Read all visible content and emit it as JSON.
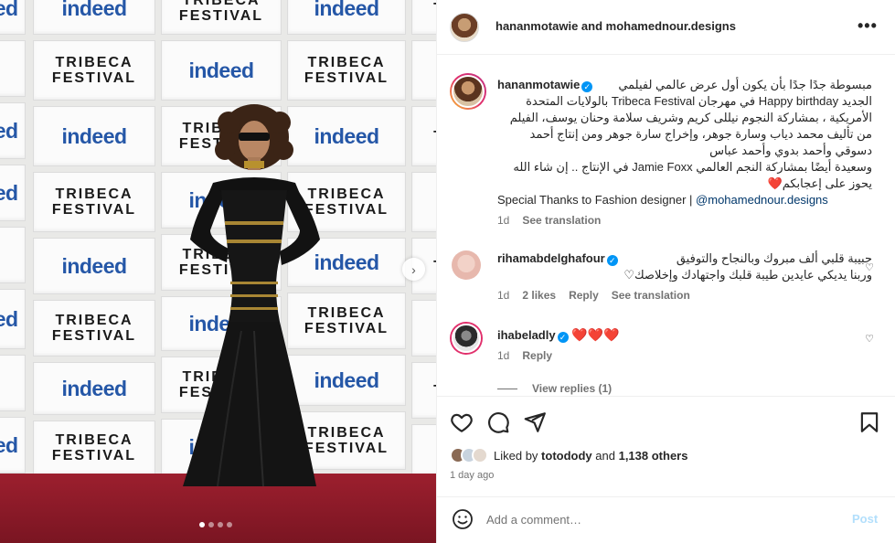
{
  "header": {
    "title": "hananmotawie and mohamednour.designs",
    "more_icon": "more-horizontal-icon"
  },
  "media": {
    "backdrop_logos": [
      "indeed",
      "TRIBECA FESTIVAL"
    ],
    "carousel_next_glyph": "›",
    "carousel_count": 4,
    "carousel_active": 0
  },
  "caption": {
    "username": "hananmotawie",
    "verified_glyph": "✓",
    "lines_ar": [
      "مبسوطة جدًا جدًا بأن يكون أول عرض عالمي لفيلمي",
      "الجديد Happy birthday في مهرجان Tribeca Festival بالولايات المتحدة",
      "الأمريكية ، بمشاركة النجوم نيللى كريم وشريف سلامة وحنان يوسف، الفيلم",
      "من تأليف محمد دياب وسارة جوهر، وإخراج سارة جوهر ومن إنتاج أحمد",
      "دسوقي وأحمد بدوي وأحمد عباس",
      "وسعيدة أيضًا بمشاركة النجم العالمي Jamie Foxx في الإنتاج .. إن شاء الله",
      "يحوز على إعجابكم❤️"
    ],
    "thanks_text": "Special Thanks to Fashion designer | ",
    "thanks_mention": "@mohamednour.designs",
    "time": "1d",
    "see_translation": "See translation"
  },
  "comments": [
    {
      "username": "rihamabdelghafour",
      "verified": true,
      "text_lines": [
        "حبيبة قلبي ألف مبروك وبالنجاح والتوفيق",
        "وربنا يديكي عايدين طيبة قلبك واجتهادك وإخلاصك♡"
      ],
      "time": "1d",
      "likes": "2 likes",
      "reply": "Reply",
      "see_translation": "See translation"
    },
    {
      "username": "ihabeladly",
      "verified": true,
      "text": "❤️❤️❤️",
      "time": "1d",
      "reply": "Reply",
      "view_replies": "View replies (1)"
    }
  ],
  "actions": {
    "like_icon": "heart-icon",
    "comment_icon": "comment-icon",
    "share_icon": "send-icon",
    "save_icon": "bookmark-icon",
    "liked_by_prefix": "Liked by",
    "liked_by_user": "totodody",
    "liked_by_and": "and",
    "liked_by_others": "1,138 others",
    "posted_time": "1 day ago"
  },
  "add_comment": {
    "emoji_icon": "smiley-icon",
    "placeholder": "Add a comment…",
    "post_label": "Post"
  },
  "colors": {
    "verified": "#0095f6",
    "link": "#00376b",
    "post_disabled": "#b2dffc",
    "heart": "#e0245e"
  }
}
